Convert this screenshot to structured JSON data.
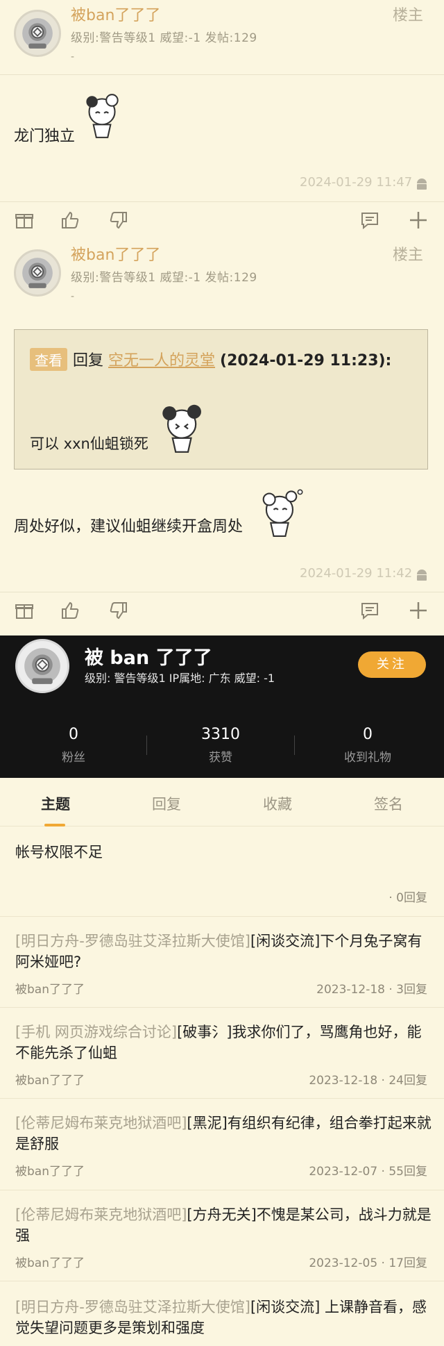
{
  "posts": [
    {
      "username": "被ban了了了",
      "meta": "级别:警告等级1  威望:-1  发帖:129",
      "dash": "-",
      "floor": "楼主",
      "content": "龙门独立",
      "time": "2024-01-29 11:47"
    },
    {
      "username": "被ban了了了",
      "meta": "级别:警告等级1  威望:-1  发帖:129",
      "dash": "-",
      "floor": "楼主",
      "quote": {
        "view_label": "查看",
        "reply_prefix": "回复",
        "reply_user": "空无一人的灵堂",
        "reply_time": "(2024-01-29 11:23):",
        "text": "可以 xxn仙蛆锁死"
      },
      "content": "周处好似，建议仙蛆继续开盒周处",
      "time": "2024-01-29 11:42"
    }
  ],
  "profile": {
    "name": "被 ban 了了了",
    "meta": "级别: 警告等级1  IP属地: 广东  威望: -1",
    "follow_label": "关注",
    "stats": [
      {
        "num": "0",
        "label": "粉丝"
      },
      {
        "num": "3310",
        "label": "获赞"
      },
      {
        "num": "0",
        "label": "收到礼物"
      }
    ]
  },
  "tabs": [
    "主题",
    "回复",
    "收藏",
    "签名"
  ],
  "topics": [
    {
      "forum": "",
      "title": "帐号权限不足",
      "author": "",
      "date": "",
      "replies": "· 0回复"
    },
    {
      "forum": "[明日方舟-罗德岛驻艾泽拉斯大使馆]",
      "title": "[闲谈交流]下个月兔子窝有阿米娅吧?",
      "author": "被ban了了了",
      "date": "2023-12-18",
      "replies": "· 3回复"
    },
    {
      "forum": "[手机 网页游戏综合讨论]",
      "title": "[破事氵]我求你们了，骂鹰角也好，能不能先杀了仙蛆",
      "author": "被ban了了了",
      "date": "2023-12-18",
      "replies": "· 24回复"
    },
    {
      "forum": "[伦蒂尼姆布莱克地狱酒吧]",
      "title": "[黑泥]有组织有纪律，组合拳打起来就是舒服",
      "author": "被ban了了了",
      "date": "2023-12-07",
      "replies": "· 55回复"
    },
    {
      "forum": "[伦蒂尼姆布莱克地狱酒吧]",
      "title": "[方舟无关]不愧是某公司，战斗力就是强",
      "author": "被ban了了了",
      "date": "2023-12-05",
      "replies": "· 17回复"
    },
    {
      "forum": "[明日方舟-罗德岛驻艾泽拉斯大使馆]",
      "title": "[闲谈交流] 上课静音看，感觉失望问题更多是策划和强度",
      "author": "",
      "date": "",
      "replies": ""
    }
  ],
  "colors": {
    "accent": "#f0a834",
    "username": "#d4a35c",
    "background": "#fbf6e0",
    "profile_bg": "#141414"
  }
}
